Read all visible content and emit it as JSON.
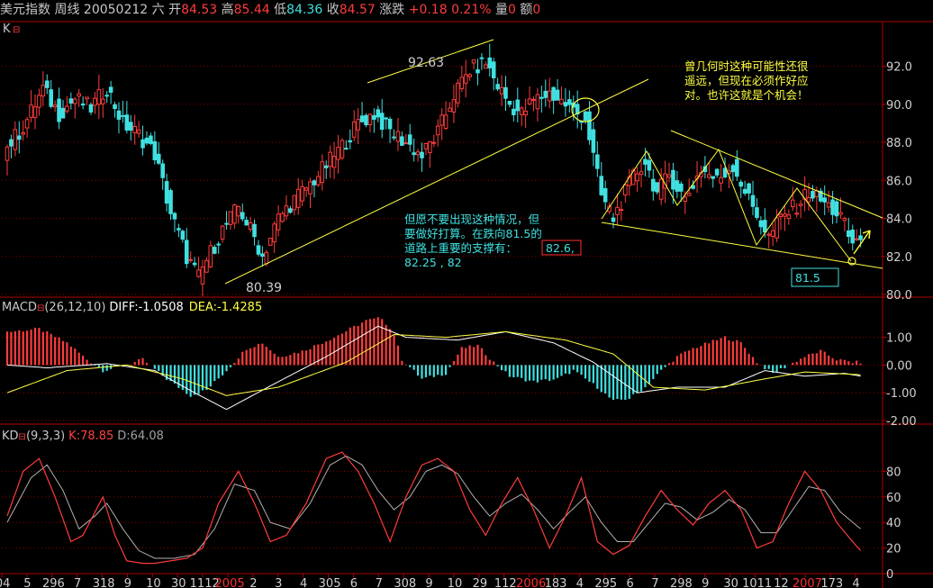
{
  "header": {
    "title": "美元指数 周线",
    "date": "20050212 六",
    "open_label": "开",
    "open": "84.53",
    "high_label": "高",
    "high": "85.44",
    "low_label": "低",
    "low": "84.36",
    "close_label": "收",
    "close": "84.57",
    "change_label": "涨跌",
    "change": "+0.18",
    "change_pct": "0.21%",
    "volume_label": "量",
    "volume": "0",
    "amount_label": "额",
    "amount": "0"
  },
  "panels": {
    "k": {
      "label": "K"
    },
    "macd": {
      "label": "MACD",
      "params": "(26,12,10)",
      "diff": "DIFF:-1.0508",
      "dea": "DEA:-1.4285"
    },
    "kd": {
      "label": "KD",
      "params": "(9,3,3)",
      "k": "K:78.85",
      "d": "D:64.08"
    }
  },
  "annotations": {
    "top_right": [
      "曾几何时这种可能性还很",
      "遥远，但现在必须作好应",
      "对。也许这就是个机会！"
    ],
    "middle": [
      "但愿不要出现这种情况，但",
      "要做好打算。在跌向81.5的",
      "道路上重要的支撑有："
    ],
    "support_1": "82.6,",
    "support_2": "82.25  , 82",
    "label_high": "92.63",
    "label_low": "80.39",
    "target_box": "81.5"
  },
  "x_labels": [
    "04",
    "5",
    "296",
    "7",
    "318",
    "9",
    "10",
    "30",
    "1112",
    "2005",
    "2",
    "3",
    "4",
    "305",
    "6",
    "7",
    "308",
    "9",
    "10",
    "29",
    "112",
    "2006",
    "183",
    "4",
    "295",
    "6",
    "7",
    "298",
    "9",
    "30",
    "1011",
    "12",
    "2007",
    "173",
    "4"
  ],
  "x_labels_red": [
    "2005",
    "2006",
    "2007"
  ],
  "chart_data": [
    {
      "type": "candlestick",
      "title": "美元指数 周线",
      "ylim": [
        80,
        93.4
      ],
      "yticks": [
        "92.0",
        "90.0",
        "88.0",
        "86.0",
        "84.0",
        "82.0",
        "80.0"
      ],
      "anchors": [
        [
          0,
          87.5
        ],
        [
          5,
          88.8
        ],
        [
          10,
          90.8
        ],
        [
          14,
          89.5
        ],
        [
          18,
          90.3
        ],
        [
          22,
          89.8
        ],
        [
          26,
          90.9
        ],
        [
          30,
          89.0
        ],
        [
          34,
          88.4
        ],
        [
          38,
          87.4
        ],
        [
          42,
          84.3
        ],
        [
          46,
          82.0
        ],
        [
          49,
          80.9
        ],
        [
          51,
          81.8
        ],
        [
          55,
          83.4
        ],
        [
          59,
          84.6
        ],
        [
          63,
          83.0
        ],
        [
          65,
          82.0
        ],
        [
          69,
          84.0
        ],
        [
          73,
          85.0
        ],
        [
          77,
          85.8
        ],
        [
          81,
          86.8
        ],
        [
          85,
          87.8
        ],
        [
          89,
          89.0
        ],
        [
          93,
          89.5
        ],
        [
          97,
          88.6
        ],
        [
          101,
          88.0
        ],
        [
          105,
          87.3
        ],
        [
          109,
          88.5
        ],
        [
          113,
          90.5
        ],
        [
          117,
          91.8
        ],
        [
          121,
          92.2
        ],
        [
          124,
          91.0
        ],
        [
          127,
          90.0
        ],
        [
          130,
          89.5
        ],
        [
          133,
          90.2
        ],
        [
          137,
          90.6
        ],
        [
          141,
          90.0
        ],
        [
          144,
          89.5
        ],
        [
          146,
          89.3
        ],
        [
          150,
          85.2
        ],
        [
          153,
          84.0
        ],
        [
          158,
          86.2
        ],
        [
          161,
          87.0
        ],
        [
          164,
          85.3
        ],
        [
          167,
          86.3
        ],
        [
          171,
          85.0
        ],
        [
          175,
          86.6
        ],
        [
          179,
          86.0
        ],
        [
          183,
          86.8
        ],
        [
          187,
          85.0
        ],
        [
          192,
          83.0
        ],
        [
          195,
          84.0
        ],
        [
          199,
          84.7
        ],
        [
          202,
          85.4
        ],
        [
          206,
          84.8
        ],
        [
          210,
          84.1
        ],
        [
          213,
          82.6
        ],
        [
          214,
          83.0
        ]
      ],
      "xlim": [
        0,
        216
      ]
    },
    {
      "type": "bar",
      "title": "MACD",
      "ylim": [
        -2.0,
        1.7
      ],
      "yticks": [
        "1.00",
        "0.00",
        "-1.00",
        "-2.00"
      ],
      "series": [
        {
          "name": "DIFF",
          "anchors": [
            [
              0,
              0.0
            ],
            [
              10,
              -0.1
            ],
            [
              25,
              0.05
            ],
            [
              37,
              -0.2
            ],
            [
              47,
              -1.0
            ],
            [
              55,
              -1.6
            ],
            [
              68,
              -0.6
            ],
            [
              80,
              0.3
            ],
            [
              93,
              1.4
            ],
            [
              100,
              1.0
            ],
            [
              113,
              0.9
            ],
            [
              125,
              1.2
            ],
            [
              137,
              0.8
            ],
            [
              147,
              0.1
            ],
            [
              158,
              -1.0
            ],
            [
              168,
              -0.8
            ],
            [
              180,
              -0.8
            ],
            [
              190,
              -0.2
            ],
            [
              200,
              -0.4
            ],
            [
              210,
              -0.3
            ],
            [
              214,
              -0.4
            ]
          ]
        },
        {
          "name": "DEA",
          "anchors": [
            [
              0,
              -1.0
            ],
            [
              15,
              -0.2
            ],
            [
              30,
              0.0
            ],
            [
              44,
              -0.5
            ],
            [
              55,
              -1.1
            ],
            [
              68,
              -0.8
            ],
            [
              85,
              0.1
            ],
            [
              97,
              1.1
            ],
            [
              110,
              1.0
            ],
            [
              125,
              1.2
            ],
            [
              140,
              0.9
            ],
            [
              152,
              0.4
            ],
            [
              162,
              -0.8
            ],
            [
              175,
              -0.9
            ],
            [
              190,
              -0.5
            ],
            [
              200,
              -0.25
            ],
            [
              214,
              -0.35
            ]
          ]
        },
        {
          "name": "MACD",
          "anchors": [
            [
              0,
              1.2
            ],
            [
              8,
              1.3
            ],
            [
              15,
              0.8
            ],
            [
              20,
              0.2
            ],
            [
              24,
              -0.2
            ],
            [
              30,
              0.0
            ],
            [
              34,
              0.2
            ],
            [
              40,
              -0.5
            ],
            [
              46,
              -1.1
            ],
            [
              50,
              -0.9
            ],
            [
              55,
              -0.2
            ],
            [
              60,
              0.6
            ],
            [
              64,
              0.8
            ],
            [
              68,
              0.3
            ],
            [
              74,
              0.5
            ],
            [
              82,
              1.0
            ],
            [
              90,
              1.6
            ],
            [
              94,
              1.7
            ],
            [
              97,
              1.1
            ],
            [
              99,
              0.2
            ],
            [
              104,
              -0.5
            ],
            [
              110,
              -0.3
            ],
            [
              114,
              0.6
            ],
            [
              118,
              0.7
            ],
            [
              122,
              0.1
            ],
            [
              126,
              -0.4
            ],
            [
              132,
              -0.6
            ],
            [
              138,
              -0.5
            ],
            [
              142,
              -0.2
            ],
            [
              148,
              -0.8
            ],
            [
              152,
              -1.3
            ],
            [
              156,
              -1.2
            ],
            [
              160,
              -0.8
            ],
            [
              164,
              -0.2
            ],
            [
              168,
              0.3
            ],
            [
              172,
              0.6
            ],
            [
              176,
              0.8
            ],
            [
              180,
              1.0
            ],
            [
              184,
              0.8
            ],
            [
              188,
              0.1
            ],
            [
              192,
              -0.3
            ],
            [
              196,
              0.0
            ],
            [
              200,
              0.3
            ],
            [
              204,
              0.5
            ],
            [
              208,
              0.2
            ],
            [
              212,
              0.1
            ],
            [
              214,
              0.1
            ]
          ]
        }
      ],
      "xlim": [
        0,
        216
      ]
    },
    {
      "type": "line",
      "title": "KD",
      "ylim": [
        0,
        100
      ],
      "yticks": [
        "80",
        "60",
        "40",
        "20",
        "0"
      ],
      "series": [
        {
          "name": "K",
          "anchors": [
            [
              0,
              45
            ],
            [
              4,
              80
            ],
            [
              8,
              90
            ],
            [
              12,
              60
            ],
            [
              16,
              25
            ],
            [
              19,
              30
            ],
            [
              22,
              48
            ],
            [
              24,
              60
            ],
            [
              27,
              30
            ],
            [
              30,
              10
            ],
            [
              34,
              8
            ],
            [
              37,
              8
            ],
            [
              41,
              10
            ],
            [
              45,
              12
            ],
            [
              49,
              20
            ],
            [
              53,
              55
            ],
            [
              58,
              80
            ],
            [
              62,
              55
            ],
            [
              66,
              25
            ],
            [
              70,
              30
            ],
            [
              75,
              55
            ],
            [
              80,
              90
            ],
            [
              84,
              95
            ],
            [
              88,
              80
            ],
            [
              92,
              55
            ],
            [
              96,
              25
            ],
            [
              100,
              60
            ],
            [
              104,
              85
            ],
            [
              108,
              90
            ],
            [
              112,
              80
            ],
            [
              116,
              50
            ],
            [
              120,
              30
            ],
            [
              124,
              55
            ],
            [
              128,
              75
            ],
            [
              132,
              50
            ],
            [
              136,
              20
            ],
            [
              140,
              45
            ],
            [
              144,
              75
            ],
            [
              148,
              25
            ],
            [
              152,
              15
            ],
            [
              156,
              22
            ],
            [
              160,
              45
            ],
            [
              164,
              65
            ],
            [
              168,
              50
            ],
            [
              172,
              38
            ],
            [
              176,
              55
            ],
            [
              180,
              65
            ],
            [
              184,
              50
            ],
            [
              188,
              20
            ],
            [
              192,
              25
            ],
            [
              196,
              55
            ],
            [
              200,
              80
            ],
            [
              204,
              65
            ],
            [
              208,
              40
            ],
            [
              212,
              25
            ],
            [
              214,
              18
            ]
          ]
        },
        {
          "name": "D",
          "anchors": [
            [
              0,
              40
            ],
            [
              6,
              75
            ],
            [
              10,
              85
            ],
            [
              14,
              65
            ],
            [
              18,
              35
            ],
            [
              22,
              45
            ],
            [
              25,
              55
            ],
            [
              29,
              35
            ],
            [
              33,
              18
            ],
            [
              37,
              12
            ],
            [
              42,
              12
            ],
            [
              47,
              15
            ],
            [
              52,
              35
            ],
            [
              57,
              70
            ],
            [
              62,
              65
            ],
            [
              66,
              40
            ],
            [
              71,
              35
            ],
            [
              76,
              55
            ],
            [
              81,
              85
            ],
            [
              85,
              92
            ],
            [
              89,
              85
            ],
            [
              93,
              65
            ],
            [
              97,
              50
            ],
            [
              101,
              60
            ],
            [
              105,
              80
            ],
            [
              109,
              85
            ],
            [
              113,
              78
            ],
            [
              117,
              60
            ],
            [
              121,
              45
            ],
            [
              125,
              55
            ],
            [
              129,
              62
            ],
            [
              133,
              50
            ],
            [
              137,
              35
            ],
            [
              141,
              48
            ],
            [
              145,
              60
            ],
            [
              149,
              40
            ],
            [
              153,
              25
            ],
            [
              157,
              25
            ],
            [
              161,
              40
            ],
            [
              165,
              55
            ],
            [
              169,
              52
            ],
            [
              173,
              42
            ],
            [
              177,
              48
            ],
            [
              181,
              58
            ],
            [
              185,
              50
            ],
            [
              189,
              32
            ],
            [
              193,
              32
            ],
            [
              197,
              50
            ],
            [
              201,
              68
            ],
            [
              205,
              65
            ],
            [
              209,
              48
            ],
            [
              214,
              35
            ]
          ]
        }
      ],
      "xlim": [
        0,
        216
      ]
    }
  ],
  "colors": {
    "up": "#ff3c3c",
    "down": "#40e0e0",
    "grid": "#8b0000",
    "axis": "#b00000",
    "yellow": "#ffff40",
    "white": "#ffffff"
  }
}
